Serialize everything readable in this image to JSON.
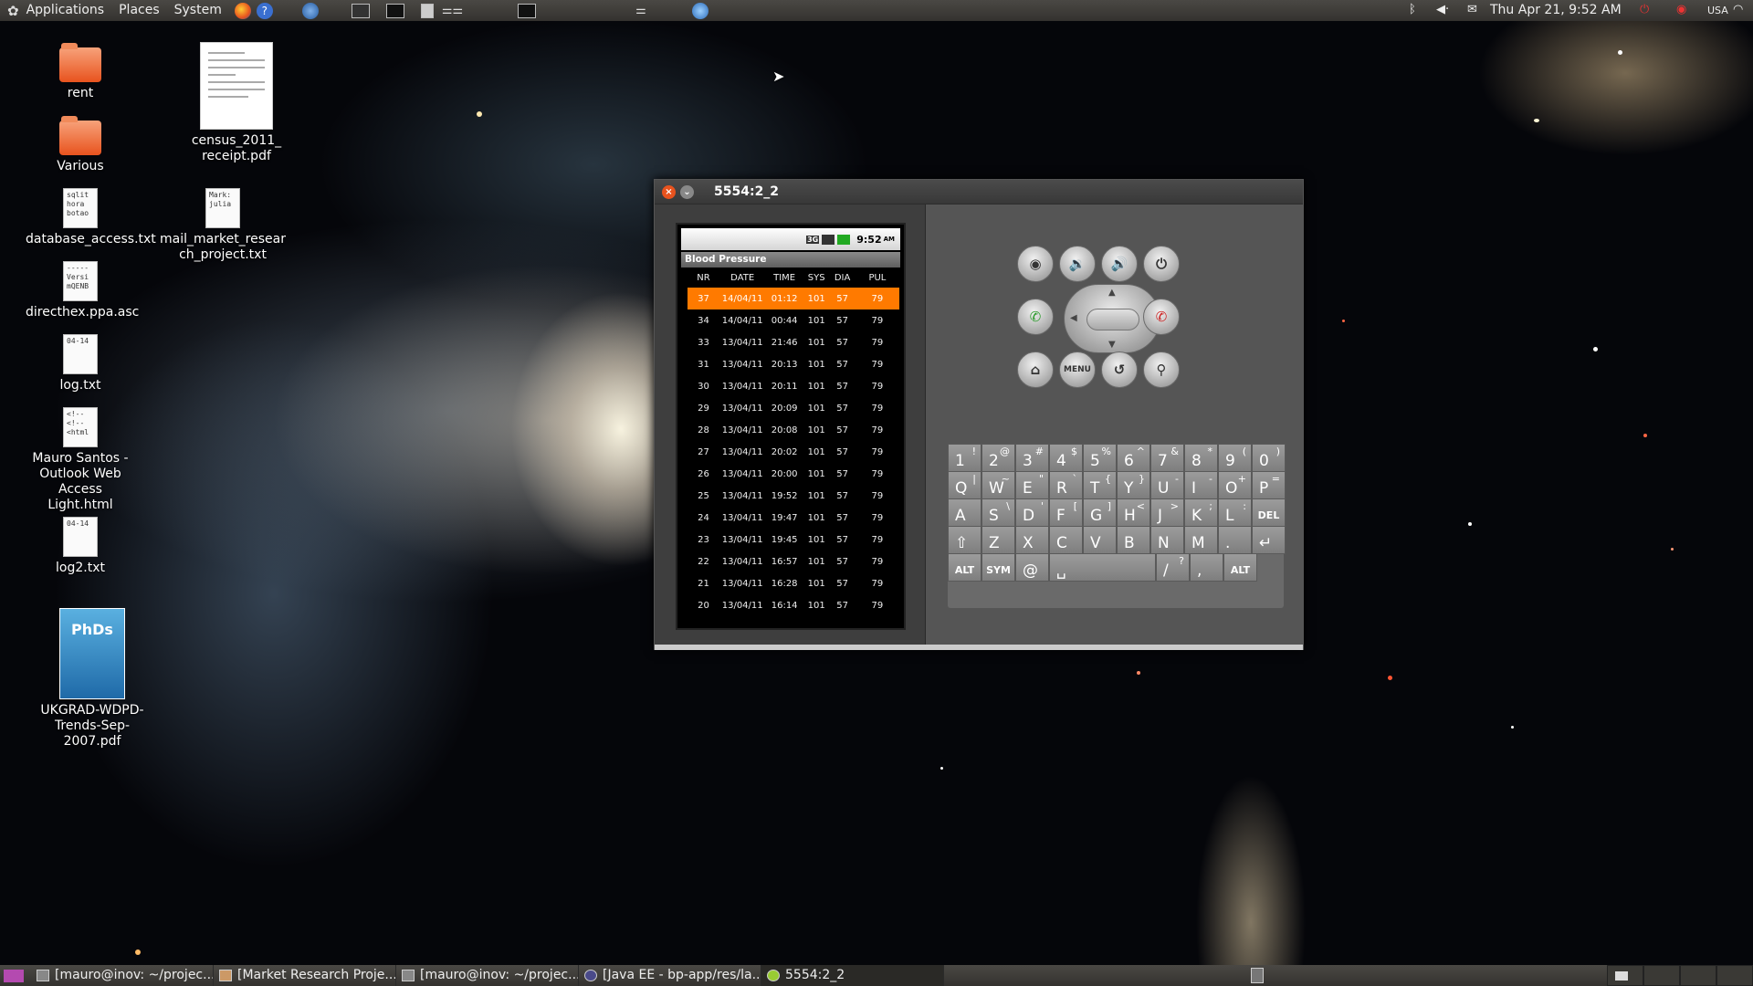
{
  "top_panel": {
    "menus": [
      "Applications",
      "Places",
      "System"
    ],
    "clock": "Thu Apr 21,  9:52 AM",
    "keyboard_layout": "USA",
    "accent_color": "#e8531e"
  },
  "desktop_icons": [
    {
      "label": "rent",
      "icon": "folder-icon"
    },
    {
      "label": "Various",
      "icon": "folder-icon"
    },
    {
      "label": "database_access.txt",
      "icon": "text-file-icon",
      "preview": "sqlit\nhora\nbotao"
    },
    {
      "label": "directhex.ppa.asc",
      "icon": "text-file-icon",
      "preview": "-----\nVersi\nmQENB"
    },
    {
      "label": "log.txt",
      "icon": "text-file-icon",
      "preview": "04-14"
    },
    {
      "label": "Mauro Santos - Outlook Web Access Light.html",
      "icon": "html-file-icon",
      "preview": "<!--\n<!--\n<html"
    },
    {
      "label": "log2.txt",
      "icon": "text-file-icon",
      "preview": "04-14"
    },
    {
      "label": "UKGRAD-WDPD-Trends-Sep-2007.pdf",
      "icon": "pdf-icon",
      "preview": "PhDs"
    },
    {
      "label": "census_2011_receipt.pdf",
      "icon": "pdf-icon"
    },
    {
      "label": "mail_market_research_project.txt",
      "icon": "text-file-icon",
      "preview": "Mark:\njulia"
    }
  ],
  "emulator": {
    "title": "5554:2_2",
    "phone_time": "9:52",
    "phone_ampm": "AM",
    "network": "3G",
    "app_title": "Blood Pressure",
    "columns": [
      "NR",
      "DATE",
      "TIME",
      "SYS",
      "DIA",
      "PUL"
    ],
    "rows": [
      [
        "37",
        "14/04/11",
        "01:12",
        "101",
        "57",
        "79"
      ],
      [
        "34",
        "14/04/11",
        "00:44",
        "101",
        "57",
        "79"
      ],
      [
        "33",
        "13/04/11",
        "21:46",
        "101",
        "57",
        "79"
      ],
      [
        "31",
        "13/04/11",
        "20:13",
        "101",
        "57",
        "79"
      ],
      [
        "30",
        "13/04/11",
        "20:11",
        "101",
        "57",
        "79"
      ],
      [
        "29",
        "13/04/11",
        "20:09",
        "101",
        "57",
        "79"
      ],
      [
        "28",
        "13/04/11",
        "20:08",
        "101",
        "57",
        "79"
      ],
      [
        "27",
        "13/04/11",
        "20:02",
        "101",
        "57",
        "79"
      ],
      [
        "26",
        "13/04/11",
        "20:00",
        "101",
        "57",
        "79"
      ],
      [
        "25",
        "13/04/11",
        "19:52",
        "101",
        "57",
        "79"
      ],
      [
        "24",
        "13/04/11",
        "19:47",
        "101",
        "57",
        "79"
      ],
      [
        "23",
        "13/04/11",
        "19:45",
        "101",
        "57",
        "79"
      ],
      [
        "22",
        "13/04/11",
        "16:57",
        "101",
        "57",
        "79"
      ],
      [
        "21",
        "13/04/11",
        "16:28",
        "101",
        "57",
        "79"
      ],
      [
        "20",
        "13/04/11",
        "16:14",
        "101",
        "57",
        "79"
      ]
    ],
    "selected_row_color": "#ff7a00",
    "controls": {
      "menu_label": "MENU"
    },
    "keyboard": {
      "row1": [
        [
          "1",
          "!"
        ],
        [
          "2",
          "@"
        ],
        [
          "3",
          "#"
        ],
        [
          "4",
          "$"
        ],
        [
          "5",
          "%"
        ],
        [
          "6",
          "^"
        ],
        [
          "7",
          "&"
        ],
        [
          "8",
          "*"
        ],
        [
          "9",
          "("
        ],
        [
          "0",
          ")"
        ]
      ],
      "row2": [
        [
          "Q",
          "|"
        ],
        [
          "W",
          "~"
        ],
        [
          "E",
          "\""
        ],
        [
          "R",
          "`"
        ],
        [
          "T",
          "{"
        ],
        [
          "Y",
          "}"
        ],
        [
          "U",
          "-"
        ],
        [
          "I",
          "-"
        ],
        [
          "O",
          "+"
        ],
        [
          "P",
          "="
        ]
      ],
      "row3": [
        [
          "A",
          ""
        ],
        [
          "S",
          "\\"
        ],
        [
          "D",
          "'"
        ],
        [
          "F",
          "["
        ],
        [
          "G",
          "]"
        ],
        [
          "H",
          "<"
        ],
        [
          "J",
          ">"
        ],
        [
          "K",
          ";"
        ],
        [
          "L",
          ":"
        ],
        [
          "DEL",
          ""
        ]
      ],
      "row4": [
        [
          "⇧",
          ""
        ],
        [
          "Z",
          ""
        ],
        [
          "X",
          ""
        ],
        [
          "C",
          ""
        ],
        [
          "V",
          ""
        ],
        [
          "B",
          ""
        ],
        [
          "N",
          ""
        ],
        [
          "M",
          ""
        ],
        [
          ".",
          ""
        ],
        [
          "↵",
          ""
        ]
      ],
      "row5": [
        [
          "ALT",
          ""
        ],
        [
          "SYM",
          ""
        ],
        [
          "@",
          ""
        ],
        [
          "␣",
          ""
        ],
        [
          "/",
          "?"
        ],
        [
          ",",
          ""
        ],
        [
          "ALT",
          ""
        ]
      ]
    }
  },
  "taskbar": {
    "items": [
      "[mauro@inov: ~/projec...",
      "[Market Research Proje...",
      "[mauro@inov: ~/projec...",
      "[Java EE - bp-app/res/la...",
      "5554:2_2"
    ]
  }
}
